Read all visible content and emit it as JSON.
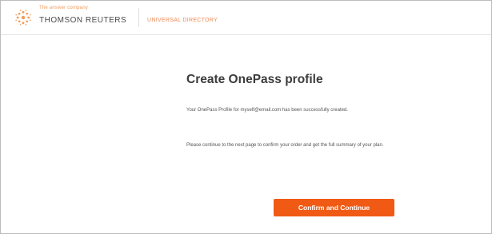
{
  "header": {
    "tagline": "The answer company",
    "brand": "THOMSON REUTERS",
    "product": "UNIVERSAL DIRECTORY"
  },
  "main": {
    "title": "Create OnePass profile",
    "paragraph_1": "Your OnePass Profile for myself@email.com has been successfully created.",
    "paragraph_2": "Please continue to the next page to confirm your order and get the full summary of your plan.",
    "confirm_button_label": "Confirm and Continue"
  },
  "colors": {
    "accent": "#f05a14",
    "logo": "#f39a56"
  },
  "icons": {
    "logo": "thomson-reuters-logo-icon"
  }
}
